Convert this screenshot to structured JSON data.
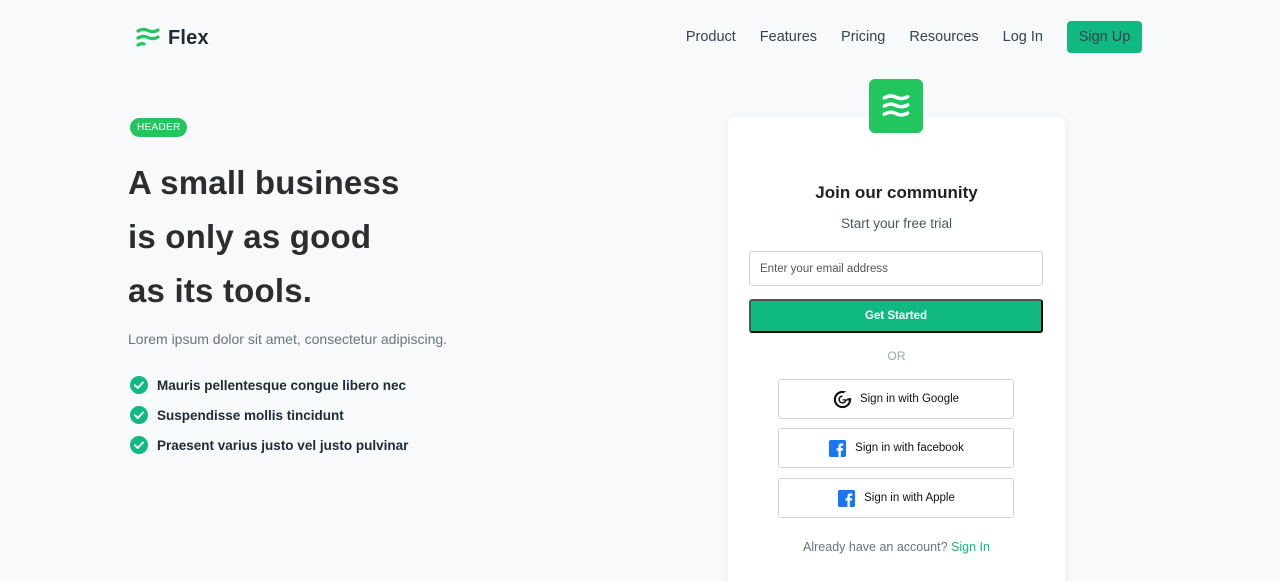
{
  "nav": {
    "brand": "Flex",
    "links": [
      "Product",
      "Features",
      "Pricing",
      "Resources"
    ],
    "login": "Log In",
    "signup": "Sign Up"
  },
  "hero": {
    "badge": "HEADER",
    "headline_lines": [
      "A small business",
      "is only as good",
      "as its tools."
    ],
    "lead": "Lorem ipsum dolor sit amet, consectetur adipiscing.",
    "features": [
      "Mauris pellentesque congue libero nec",
      "Suspendisse mollis tincidunt",
      "Praesent varius justo vel justo pulvinar"
    ]
  },
  "signup_card": {
    "title": "Join our community",
    "subtitle": "Start your free trial",
    "email_placeholder": "Enter your email address",
    "cta": "Get Started",
    "divider": "OR",
    "social": {
      "google": "Sign in with Google",
      "facebook": "Sign in with facebook",
      "apple": "Sign in with Apple"
    },
    "have_account": "Already have an account?",
    "signin": "Sign In"
  },
  "colors": {
    "accent": "#10b981",
    "badge_green": "#22c55e",
    "facebook_blue": "#1877f2",
    "background": "#f7f9fb"
  },
  "icons": {
    "brand": "flex-logo-icon",
    "check": "check-circle-icon",
    "google": "google-icon",
    "facebook": "facebook-icon",
    "apple": "facebook-icon"
  }
}
